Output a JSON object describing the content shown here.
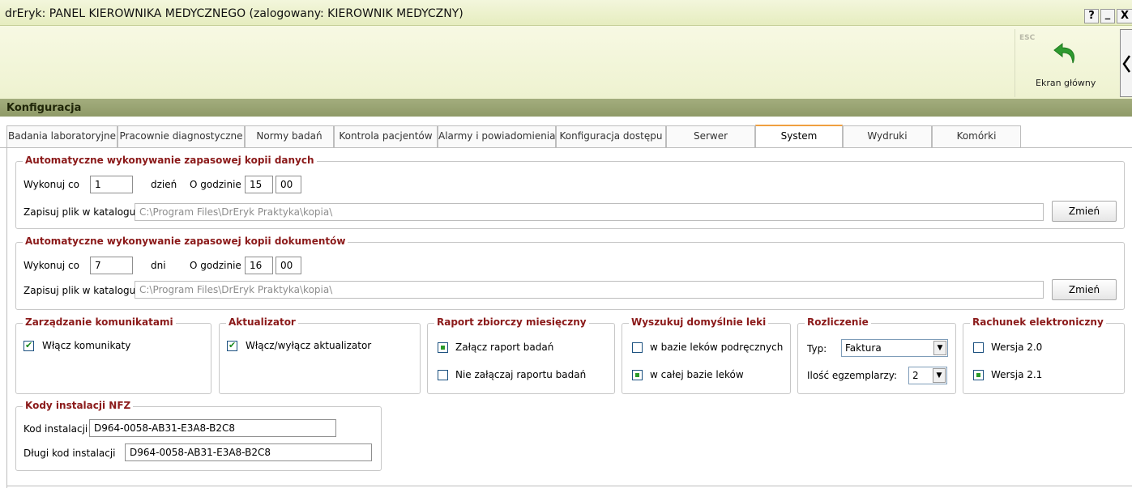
{
  "window": {
    "title": "drEryk: PANEL KIEROWNIKA MEDYCZNEGO (zalogowany: KIEROWNIK MEDYCZNY)",
    "help_label": "?",
    "minimize_label": "_",
    "close_label": "X"
  },
  "toolbar": {
    "esc_label": "ESC",
    "home_label": "Ekran główny"
  },
  "section": {
    "title": "Konfiguracja"
  },
  "tabs": [
    {
      "label": "Badania laboratoryjne"
    },
    {
      "label": "Pracownie diagnostyczne"
    },
    {
      "label": "Normy badań"
    },
    {
      "label": "Kontrola pacjentów"
    },
    {
      "label": "Alarmy i powiadomienia"
    },
    {
      "label": "Konfiguracja dostępu"
    },
    {
      "label": "Serwer"
    },
    {
      "label": "System"
    },
    {
      "label": "Wydruki"
    },
    {
      "label": "Komórki"
    }
  ],
  "active_tab": "System",
  "backup_data": {
    "legend": "Automatyczne wykonywanie zapasowej kopii danych",
    "every_label": "Wykonuj co",
    "every_value": "1",
    "unit": "dzień",
    "at_label": "O godzinie",
    "hour": "15",
    "minute": "00",
    "dir_label": "Zapisuj plik w katalogu",
    "dir_value": "C:\\Program Files\\DrEryk Praktyka\\kopia\\",
    "change_label": "Zmień"
  },
  "backup_docs": {
    "legend": "Automatyczne wykonywanie zapasowej kopii dokumentów",
    "every_label": "Wykonuj co",
    "every_value": "7",
    "unit": "dni",
    "at_label": "O godzinie",
    "hour": "16",
    "minute": "00",
    "dir_label": "Zapisuj plik w katalogu",
    "dir_value": "C:\\Program Files\\DrEryk Praktyka\\kopia\\",
    "change_label": "Zmień"
  },
  "messages": {
    "legend": "Zarządzanie komunikatami",
    "option": "Włącz komunikaty",
    "checked": true
  },
  "updater": {
    "legend": "Aktualizator",
    "option": "Włącz/wyłącz aktualizator",
    "checked": true
  },
  "monthly_report": {
    "legend": "Raport zbiorczy miesięczny",
    "options": [
      {
        "label": "Załącz raport badań",
        "selected": true
      },
      {
        "label": "Nie załączaj raportu badań",
        "selected": false
      }
    ]
  },
  "drug_search": {
    "legend": "Wyszukuj domyślnie leki",
    "options": [
      {
        "label": "w bazie leków podręcznych",
        "selected": false
      },
      {
        "label": "w całej bazie leków",
        "selected": true
      }
    ]
  },
  "billing": {
    "legend": "Rozliczenie",
    "type_label": "Typ:",
    "type_value": "Faktura",
    "copies_label": "Ilość egzemplarzy:",
    "copies_value": "2"
  },
  "e_invoice": {
    "legend": "Rachunek elektroniczny",
    "options": [
      {
        "label": "Wersja 2.0",
        "selected": false
      },
      {
        "label": "Wersja 2.1",
        "selected": true
      }
    ]
  },
  "nfz_codes": {
    "legend": "Kody instalacji NFZ",
    "code_label": "Kod instalacji",
    "code_value": "D964-0058-AB31-E3A8-B2C8",
    "long_label": "Długi kod instalacji",
    "long_value": "D964-0058-AB31-E3A8-B2C8"
  },
  "colors": {
    "legend": "#8b1a1a",
    "section_bar": "#97a26f",
    "accent_tab": "#f0a040",
    "check": "#1e8a1e"
  },
  "icons": {
    "home": "undo-arrow-icon",
    "collapse": "chevron-left-icon"
  }
}
